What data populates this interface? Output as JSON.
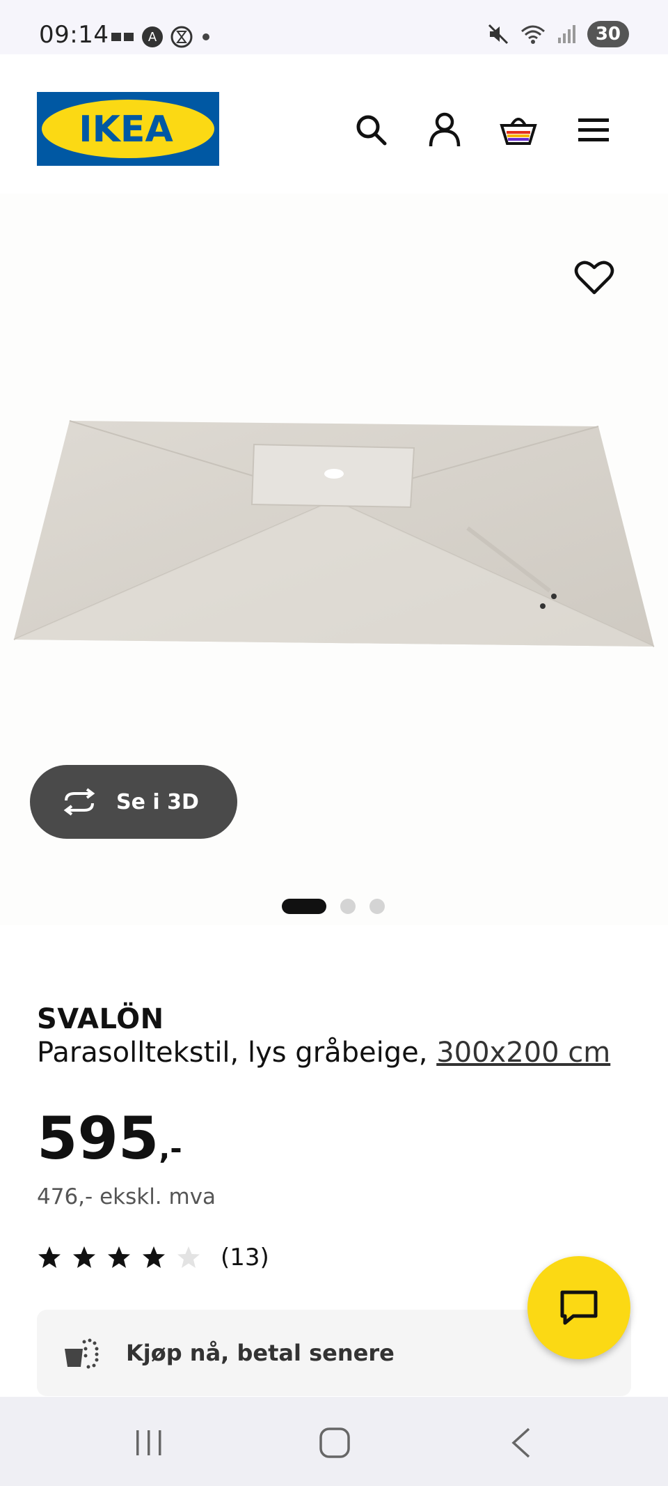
{
  "status_bar": {
    "time": "09:14",
    "battery": "30"
  },
  "header": {
    "logo_text": "IKEA",
    "icons": [
      "search-icon",
      "account-icon",
      "basket-icon",
      "menu-icon"
    ]
  },
  "gallery": {
    "view3d_label": "Se i 3D",
    "slide_count": 3,
    "active_slide": 1
  },
  "product": {
    "name": "SVALÖN",
    "description": "Parasolltekstil, lys gråbeige, ",
    "size": "300x200 cm",
    "price": "595",
    "price_suffix": ",-",
    "price_ex_vat": "476,- ekskl. mva",
    "rating": 4,
    "rating_max": 5,
    "review_count": "(13)"
  },
  "bnpl": {
    "label": "Kjøp nå, betal senere"
  },
  "colors": {
    "ikea_blue": "#0058a3",
    "ikea_yellow": "#fbd914",
    "dark_button": "#4a4a4a"
  }
}
